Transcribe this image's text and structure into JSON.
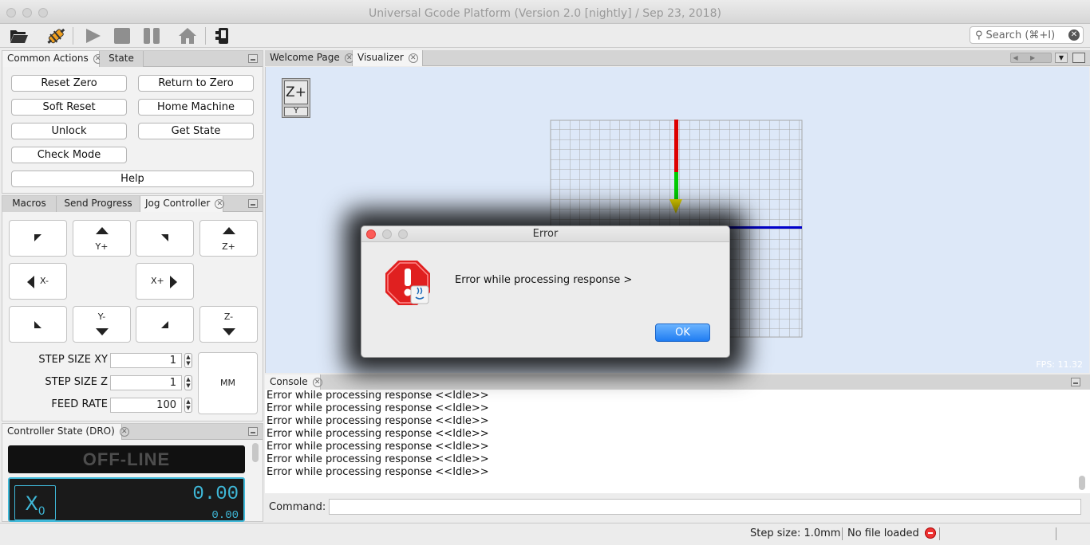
{
  "window": {
    "title": "Universal Gcode Platform (Version 2.0 [nightly]  / Sep 23, 2018)"
  },
  "toolbar": {
    "icons": [
      "folder-open-icon",
      "connect-icon",
      "play-icon",
      "stop-icon",
      "pause-icon",
      "home-icon",
      "machine-icon"
    ],
    "search_placeholder": "Search (⌘+I)"
  },
  "left_top": {
    "tabs": [
      {
        "label": "Common Actions",
        "closable": true
      },
      {
        "label": "State",
        "closable": false
      }
    ],
    "buttons": {
      "reset_zero": "Reset Zero",
      "return_to_zero": "Return to Zero",
      "soft_reset": "Soft Reset",
      "home_machine": "Home Machine",
      "unlock": "Unlock",
      "get_state": "Get State",
      "check_mode": "Check Mode",
      "help": "Help"
    }
  },
  "left_mid": {
    "tabs": [
      {
        "label": "Macros"
      },
      {
        "label": "Send Progress"
      },
      {
        "label": "Jog Controller",
        "closable": true
      }
    ],
    "jog": {
      "y_plus": "Y+",
      "z_plus": "Z+",
      "x_minus": "X-",
      "x_plus": "X+",
      "y_minus": "Y-",
      "z_minus": "Z-"
    },
    "step_xy_label": "STEP SIZE XY",
    "step_xy_value": "1",
    "step_z_label": "STEP SIZE Z",
    "step_z_value": "1",
    "feed_label": "FEED RATE",
    "feed_value": "100",
    "units": "MM"
  },
  "left_bottom": {
    "tab": "Controller State (DRO)",
    "status": "OFF-LINE",
    "axis_label": "X",
    "axis_sub": "0",
    "work_value": "0.00",
    "machine_value": "0.00"
  },
  "editor": {
    "tabs": [
      {
        "label": "Welcome Page"
      },
      {
        "label": "Visualizer"
      }
    ],
    "view_cube": {
      "top": "Z+",
      "bottom": "Y"
    },
    "fps": "FPS: 11.32"
  },
  "console": {
    "tab": "Console",
    "lines": [
      "Error while processing response <<Idle>>",
      "Error while processing response <<Idle>>",
      "Error while processing response <<Idle>>",
      "Error while processing response <<Idle>>",
      "Error while processing response <<Idle>>",
      "Error while processing response <<Idle>>",
      "Error while processing response <<Idle>>"
    ],
    "command_label": "Command:",
    "command_value": ""
  },
  "statusbar": {
    "step_size": "Step size: 1.0mm",
    "file_status": "No file loaded"
  },
  "dialog": {
    "title": "Error",
    "message": "Error while processing response >",
    "ok": "OK"
  },
  "colors": {
    "accent": "#1f7cf2",
    "viz_bg": "#dde8f8",
    "axis_x": "#0000cc",
    "axis_y": "#00cc00",
    "axis_z": "#dd0000",
    "dro_border": "#3fb8d8",
    "dro_value": "#3fb8d8"
  }
}
